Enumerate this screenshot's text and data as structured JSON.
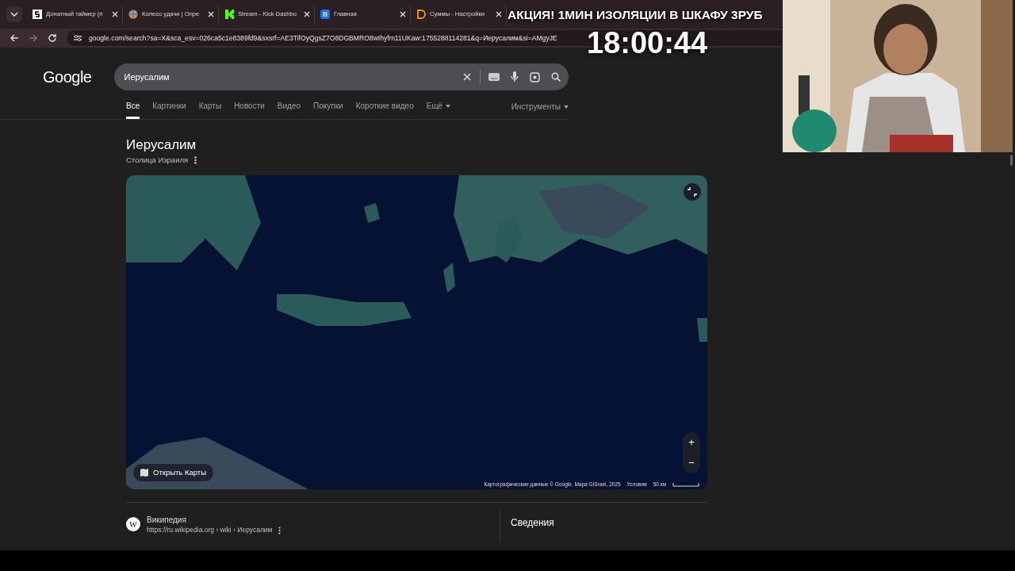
{
  "browser": {
    "tabs": [
      {
        "title": "Донатный таймер (п",
        "selected": false
      },
      {
        "title": "Колесо удачи | Опре",
        "selected": false
      },
      {
        "title": "Stream - Kick Dashbo",
        "selected": false
      },
      {
        "title": "Главная",
        "selected": false
      },
      {
        "title": "Суммы - Настройки",
        "selected": false
      }
    ],
    "address": "google.com/search?sa=X&sca_esv=026ca5c1e8389fd9&sxsrf=AE3TifOyQgsZ7O8DGBMRO8wIhyfm11UKaw:1755288114281&q=Иерусалим&si=AMgyJE"
  },
  "stream_overlay": {
    "banner": "АКЦИЯ! 1МИН ИЗОЛЯЦИИ В ШКАФУ 3РУБ",
    "timer": "18:00:44"
  },
  "search": {
    "logo": "Google",
    "query": "Иерусалим"
  },
  "nav_tabs": [
    {
      "label": "Все",
      "selected": true,
      "kind": "tab"
    },
    {
      "label": "Картинки",
      "selected": false,
      "kind": "tab"
    },
    {
      "label": "Карты",
      "selected": false,
      "kind": "tab"
    },
    {
      "label": "Новости",
      "selected": false,
      "kind": "tab"
    },
    {
      "label": "Видео",
      "selected": false,
      "kind": "tab"
    },
    {
      "label": "Покупки",
      "selected": false,
      "kind": "tab"
    },
    {
      "label": "Короткие видео",
      "selected": false,
      "kind": "tab"
    },
    {
      "label": "Ещё",
      "selected": false,
      "kind": "menu"
    }
  ],
  "tools": "Инструменты",
  "entity": {
    "title": "Иерусалим",
    "subtitle": "Столица Израиля"
  },
  "map": {
    "open_button": "Открыть Карты",
    "attribution": "Картографические данные © Google, Mapa GISrael, 2025",
    "terms": "Условия",
    "scale": "50 км",
    "zoom_in": "+",
    "zoom_out": "−"
  },
  "result": {
    "favicon": "W",
    "source": "Википедия",
    "url": "https://ru.wikipedia.org › wiki › Иерусалим"
  },
  "panel": {
    "heading": "Сведения"
  }
}
